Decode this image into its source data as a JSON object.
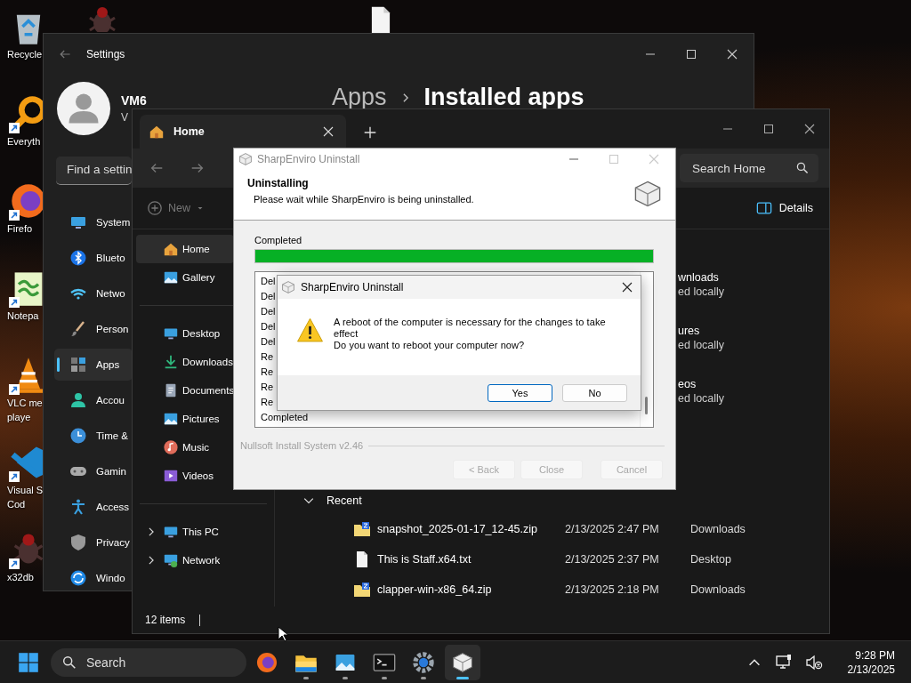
{
  "desktop_icons": [
    {
      "lines": [
        "Recycle"
      ],
      "kind": "recycle",
      "shortcut": false
    },
    {
      "lines": [
        "Everyth"
      ],
      "kind": "magnifier",
      "shortcut": true
    },
    {
      "lines": [
        "Firefo"
      ],
      "kind": "firefox",
      "shortcut": true
    },
    {
      "lines": [
        "Notepa"
      ],
      "kind": "notepad",
      "shortcut": true
    },
    {
      "lines": [
        "VLC me",
        "playe"
      ],
      "kind": "vlc",
      "shortcut": true
    },
    {
      "lines": [
        "Visual S",
        "Cod"
      ],
      "kind": "vscode",
      "shortcut": true
    },
    {
      "lines": [
        "x32db"
      ],
      "kind": "bug",
      "shortcut": true
    }
  ],
  "settings": {
    "title": "Settings",
    "user": {
      "name": "VM6",
      "detail": "V"
    },
    "search": {
      "placeholder": "Find a settin"
    },
    "nav": [
      {
        "label": "System",
        "kind": "system",
        "selected": false
      },
      {
        "label": "Blueto",
        "kind": "bluetooth",
        "selected": false
      },
      {
        "label": "Netwo",
        "kind": "wifi",
        "selected": false
      },
      {
        "label": "Person",
        "kind": "brush",
        "selected": false
      },
      {
        "label": "Apps",
        "kind": "apps",
        "selected": true
      },
      {
        "label": "Accou",
        "kind": "account",
        "selected": false
      },
      {
        "label": "Time &",
        "kind": "time",
        "selected": false
      },
      {
        "label": "Gamin",
        "kind": "gaming",
        "selected": false
      },
      {
        "label": "Access",
        "kind": "accessibility",
        "selected": false
      },
      {
        "label": "Privacy",
        "kind": "privacy",
        "selected": false
      },
      {
        "label": "Windo",
        "kind": "update",
        "selected": false
      }
    ],
    "breadcrumb": [
      "Apps",
      "Installed apps"
    ]
  },
  "explorer": {
    "tab": {
      "label": "Home"
    },
    "search": {
      "placeholder": "Search Home"
    },
    "toolbar": {
      "new": {
        "label": "New",
        "disabled": true
      },
      "details": "Details"
    },
    "sidebar_groups": [
      [
        {
          "label": "Home",
          "kind": "home",
          "selected": true,
          "expandable": false
        },
        {
          "label": "Gallery",
          "kind": "gallery",
          "selected": false,
          "expandable": false
        }
      ],
      [
        {
          "label": "Desktop",
          "kind": "desktop",
          "selected": false,
          "expandable": false
        },
        {
          "label": "Downloads",
          "kind": "downloads",
          "selected": false,
          "expandable": false
        },
        {
          "label": "Documents",
          "kind": "documents",
          "selected": false,
          "expandable": false
        },
        {
          "label": "Pictures",
          "kind": "gallery",
          "selected": false,
          "expandable": false
        },
        {
          "label": "Music",
          "kind": "music",
          "selected": false,
          "expandable": false
        },
        {
          "label": "Videos",
          "kind": "videos",
          "selected": false,
          "expandable": false
        }
      ],
      [
        {
          "label": "This PC",
          "kind": "desktop",
          "selected": false,
          "expandable": true
        },
        {
          "label": "Network",
          "kind": "netdrive",
          "selected": false,
          "expandable": true
        }
      ]
    ],
    "folders": [
      {
        "name": "wnloads",
        "status": "ed locally"
      },
      {
        "name": "ures",
        "status": "ed locally"
      },
      {
        "name": "eos",
        "status": "ed locally"
      }
    ],
    "recent": {
      "title": "Recent",
      "expanded": true,
      "rows": [
        {
          "name": "snapshot_2025-01-17_12-45.zip",
          "date": "2/13/2025 2:47 PM",
          "location": "Downloads",
          "kind": "zip"
        },
        {
          "name": "This is Staff.x64.txt",
          "date": "2/13/2025 2:37 PM",
          "location": "Desktop",
          "kind": "txt"
        },
        {
          "name": "clapper-win-x86_64.zip",
          "date": "2/13/2025 2:18 PM",
          "location": "Downloads",
          "kind": "zip"
        }
      ]
    },
    "status": "12 items"
  },
  "installer": {
    "title": "SharpEnviro Uninstall",
    "controls": [
      {
        "kind": "minimize",
        "disabled": false
      },
      {
        "kind": "maximize",
        "disabled": true
      },
      {
        "kind": "close",
        "disabled": true
      }
    ],
    "heading": "Uninstalling",
    "subheading": "Please wait while SharpEnviro is being uninstalled.",
    "progress_label": "Completed",
    "level": 1,
    "log": [
      "Del",
      "Del",
      "Del",
      "Del",
      "Del",
      "Re",
      "Re",
      "Re",
      "Re",
      "Completed"
    ],
    "brand": "Nullsoft Install System v2.46",
    "buttons": [
      {
        "label": "< Back",
        "disabled": true
      },
      {
        "label": "Close",
        "disabled": true
      },
      {
        "label": "Cancel",
        "disabled": true
      }
    ]
  },
  "message_box": {
    "title": "SharpEnviro Uninstall",
    "lines": [
      "A reboot of the computer is necessary for the changes to take effect",
      "Do you want to reboot your computer now?"
    ],
    "buttons": [
      {
        "label": "Yes",
        "default": true
      },
      {
        "label": "No",
        "default": false
      }
    ]
  },
  "taskbar": {
    "search": {
      "placeholder": "Search"
    },
    "apps": [
      {
        "kind": "firefox",
        "running": false,
        "selected": false
      },
      {
        "kind": "folder",
        "running": true,
        "selected": false
      },
      {
        "kind": "photos",
        "running": true,
        "selected": false
      },
      {
        "kind": "terminal",
        "running": true,
        "selected": false
      },
      {
        "kind": "gear",
        "running": true,
        "selected": false
      },
      {
        "kind": "cube",
        "running": true,
        "selected": true
      }
    ],
    "time": "9:28 PM",
    "date": "2/13/2025"
  }
}
